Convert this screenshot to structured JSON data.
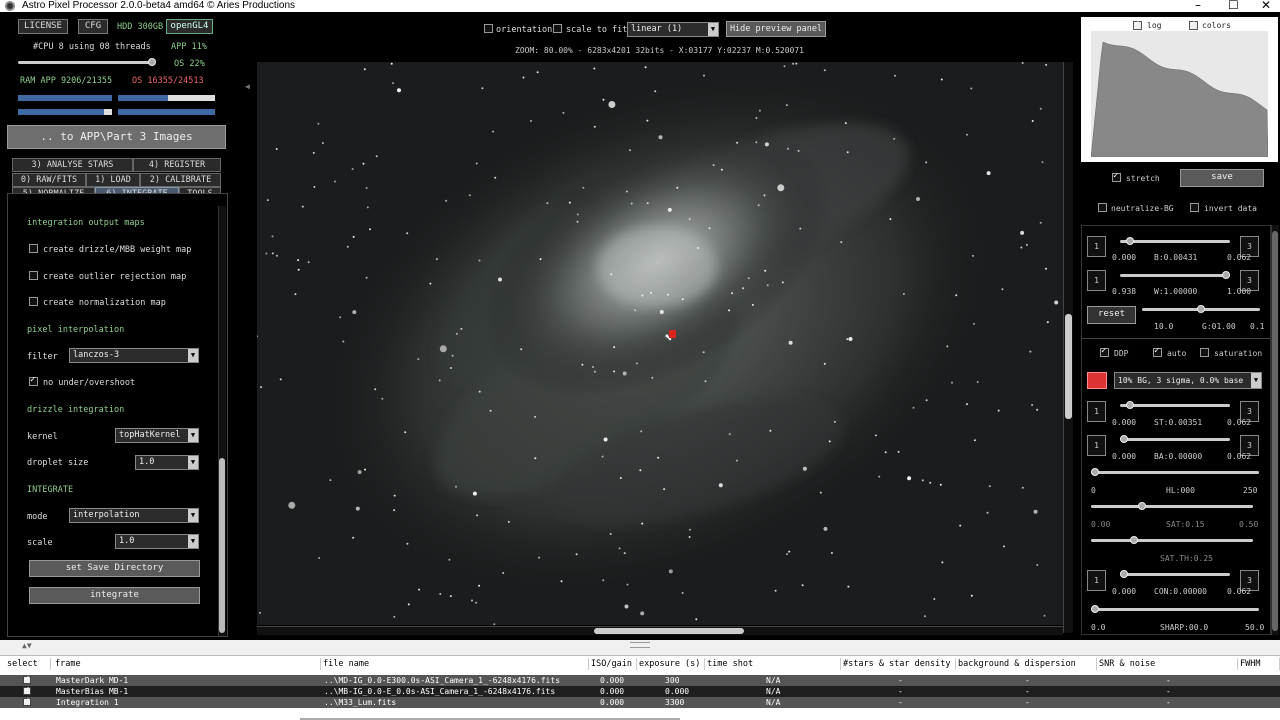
{
  "window": {
    "title": "Astro Pixel Processor 2.0.0-beta4 amd64 © Aries Productions"
  },
  "left": {
    "license": "LICENSE",
    "cfg": "CFG",
    "hdd": "HDD 300GB",
    "opengl": "openGL4",
    "cpu": "#CPU 8  using 08 threads",
    "app_pct": "APP 11%",
    "os_pct": "OS 22%",
    "ram": "RAM  APP 9206/21355",
    "os_ram": "OS 16355/24513",
    "path": ".. to APP\\Part 3 Images",
    "tabs": [
      "3) ANALYSE STARS",
      "4) REGISTER",
      "0) RAW/FITS",
      "1) LOAD",
      "2) CALIBRATE",
      "5) NORMALIZE",
      "6) INTEGRATE",
      "TOOLS"
    ],
    "integrate": {
      "output_maps": "integration output maps",
      "drizzle_map": "create drizzle/MBB weight map",
      "outlier_map": "create outlier rejection map",
      "norm_map": "create normalization map",
      "pixel_interp": "pixel interpolation",
      "filter_label": "filter",
      "filter_value": "lanczos-3",
      "no_under": "no under/overshoot",
      "drizzle_integration": "drizzle integration",
      "kernel_label": "kernel",
      "kernel_value": "topHatKernel",
      "droplet_label": "droplet size",
      "droplet_value": "1.0",
      "integrate_heading": "INTEGRATE",
      "mode_label": "mode",
      "mode_value": "interpolation",
      "scale_label": "scale",
      "scale_value": "1.0",
      "save_dir": "set Save Directory",
      "integrate_btn": "integrate"
    }
  },
  "top": {
    "orientation": "orientation",
    "scale_to_fit": "scale to fit",
    "stretch_mode": "linear (1)",
    "hide_preview": "Hide preview panel",
    "zoom": "ZOOM: 80.00% - 6283x4201 32bits - X:03177 Y:02237 M:0.520071"
  },
  "right": {
    "log": "log",
    "colors": "colors",
    "stretch": "stretch",
    "save": "save",
    "neutralize": "neutralize-BG",
    "invert": "invert data",
    "b_min": "0.000",
    "b_val": "B:0.00431",
    "b_max": "0.062",
    "w_min": "0.938",
    "w_val": "W:1.00000",
    "w_max": "1.000",
    "reset": "reset",
    "g_min": "10.0",
    "g_val": "G:01.00",
    "g_max": "0.1",
    "ddp": "DDP",
    "auto": "auto",
    "saturation": "saturation",
    "preset": "10% BG, 3 sigma, 0.0% base",
    "st_min": "0.000",
    "st_val": "ST:0.00351",
    "st_max": "0.062",
    "ba_min": "0.000",
    "ba_val": "BA:0.00000",
    "ba_max": "0.062",
    "hl_min": "0",
    "hl_val": "HL:000",
    "hl_max": "250",
    "sat_min": "0.00",
    "sat_val": "SAT:0.15",
    "sat_max": "0.50",
    "satth_val": "SAT.TH:0.25",
    "con_min": "0.000",
    "con_val": "CON:0.00000",
    "con_max": "0.062",
    "sharp_min": "0.0",
    "sharp_val": "SHARP:00.0",
    "sharp_max": "50.0",
    "one": "1",
    "three": "3",
    "stretch_fraction": 0.2,
    "histogram_shape": "peaked-left"
  },
  "table": {
    "headers": [
      "select",
      "frame",
      "file name",
      "ISO/gain",
      "exposure (s)",
      "time shot",
      "#stars & star density",
      "background & dispersion",
      "SNR & noise",
      "FWHM"
    ],
    "rows": [
      {
        "frame": "MasterDark  MD-1",
        "file": "..\\MD-IG_0.0-E300.0s-ASI_Camera_1_-6248x4176.fits",
        "iso": "0.000",
        "exp": "300",
        "time": "N/A",
        "stars": "-",
        "bg": "-",
        "snr": "-"
      },
      {
        "frame": "MasterBias  MB-1",
        "file": "..\\MB-IG_0.0-E_0.0s-ASI_Camera_1_-6248x4176.fits",
        "iso": "0.000",
        "exp": "0.000",
        "time": "N/A",
        "stars": "-",
        "bg": "-",
        "snr": "-"
      },
      {
        "frame": "Integration 1",
        "file": "..\\M33_Lum.fits",
        "iso": "0.000",
        "exp": "3300",
        "time": "N/A",
        "stars": "-",
        "bg": "-",
        "snr": "-"
      }
    ]
  }
}
